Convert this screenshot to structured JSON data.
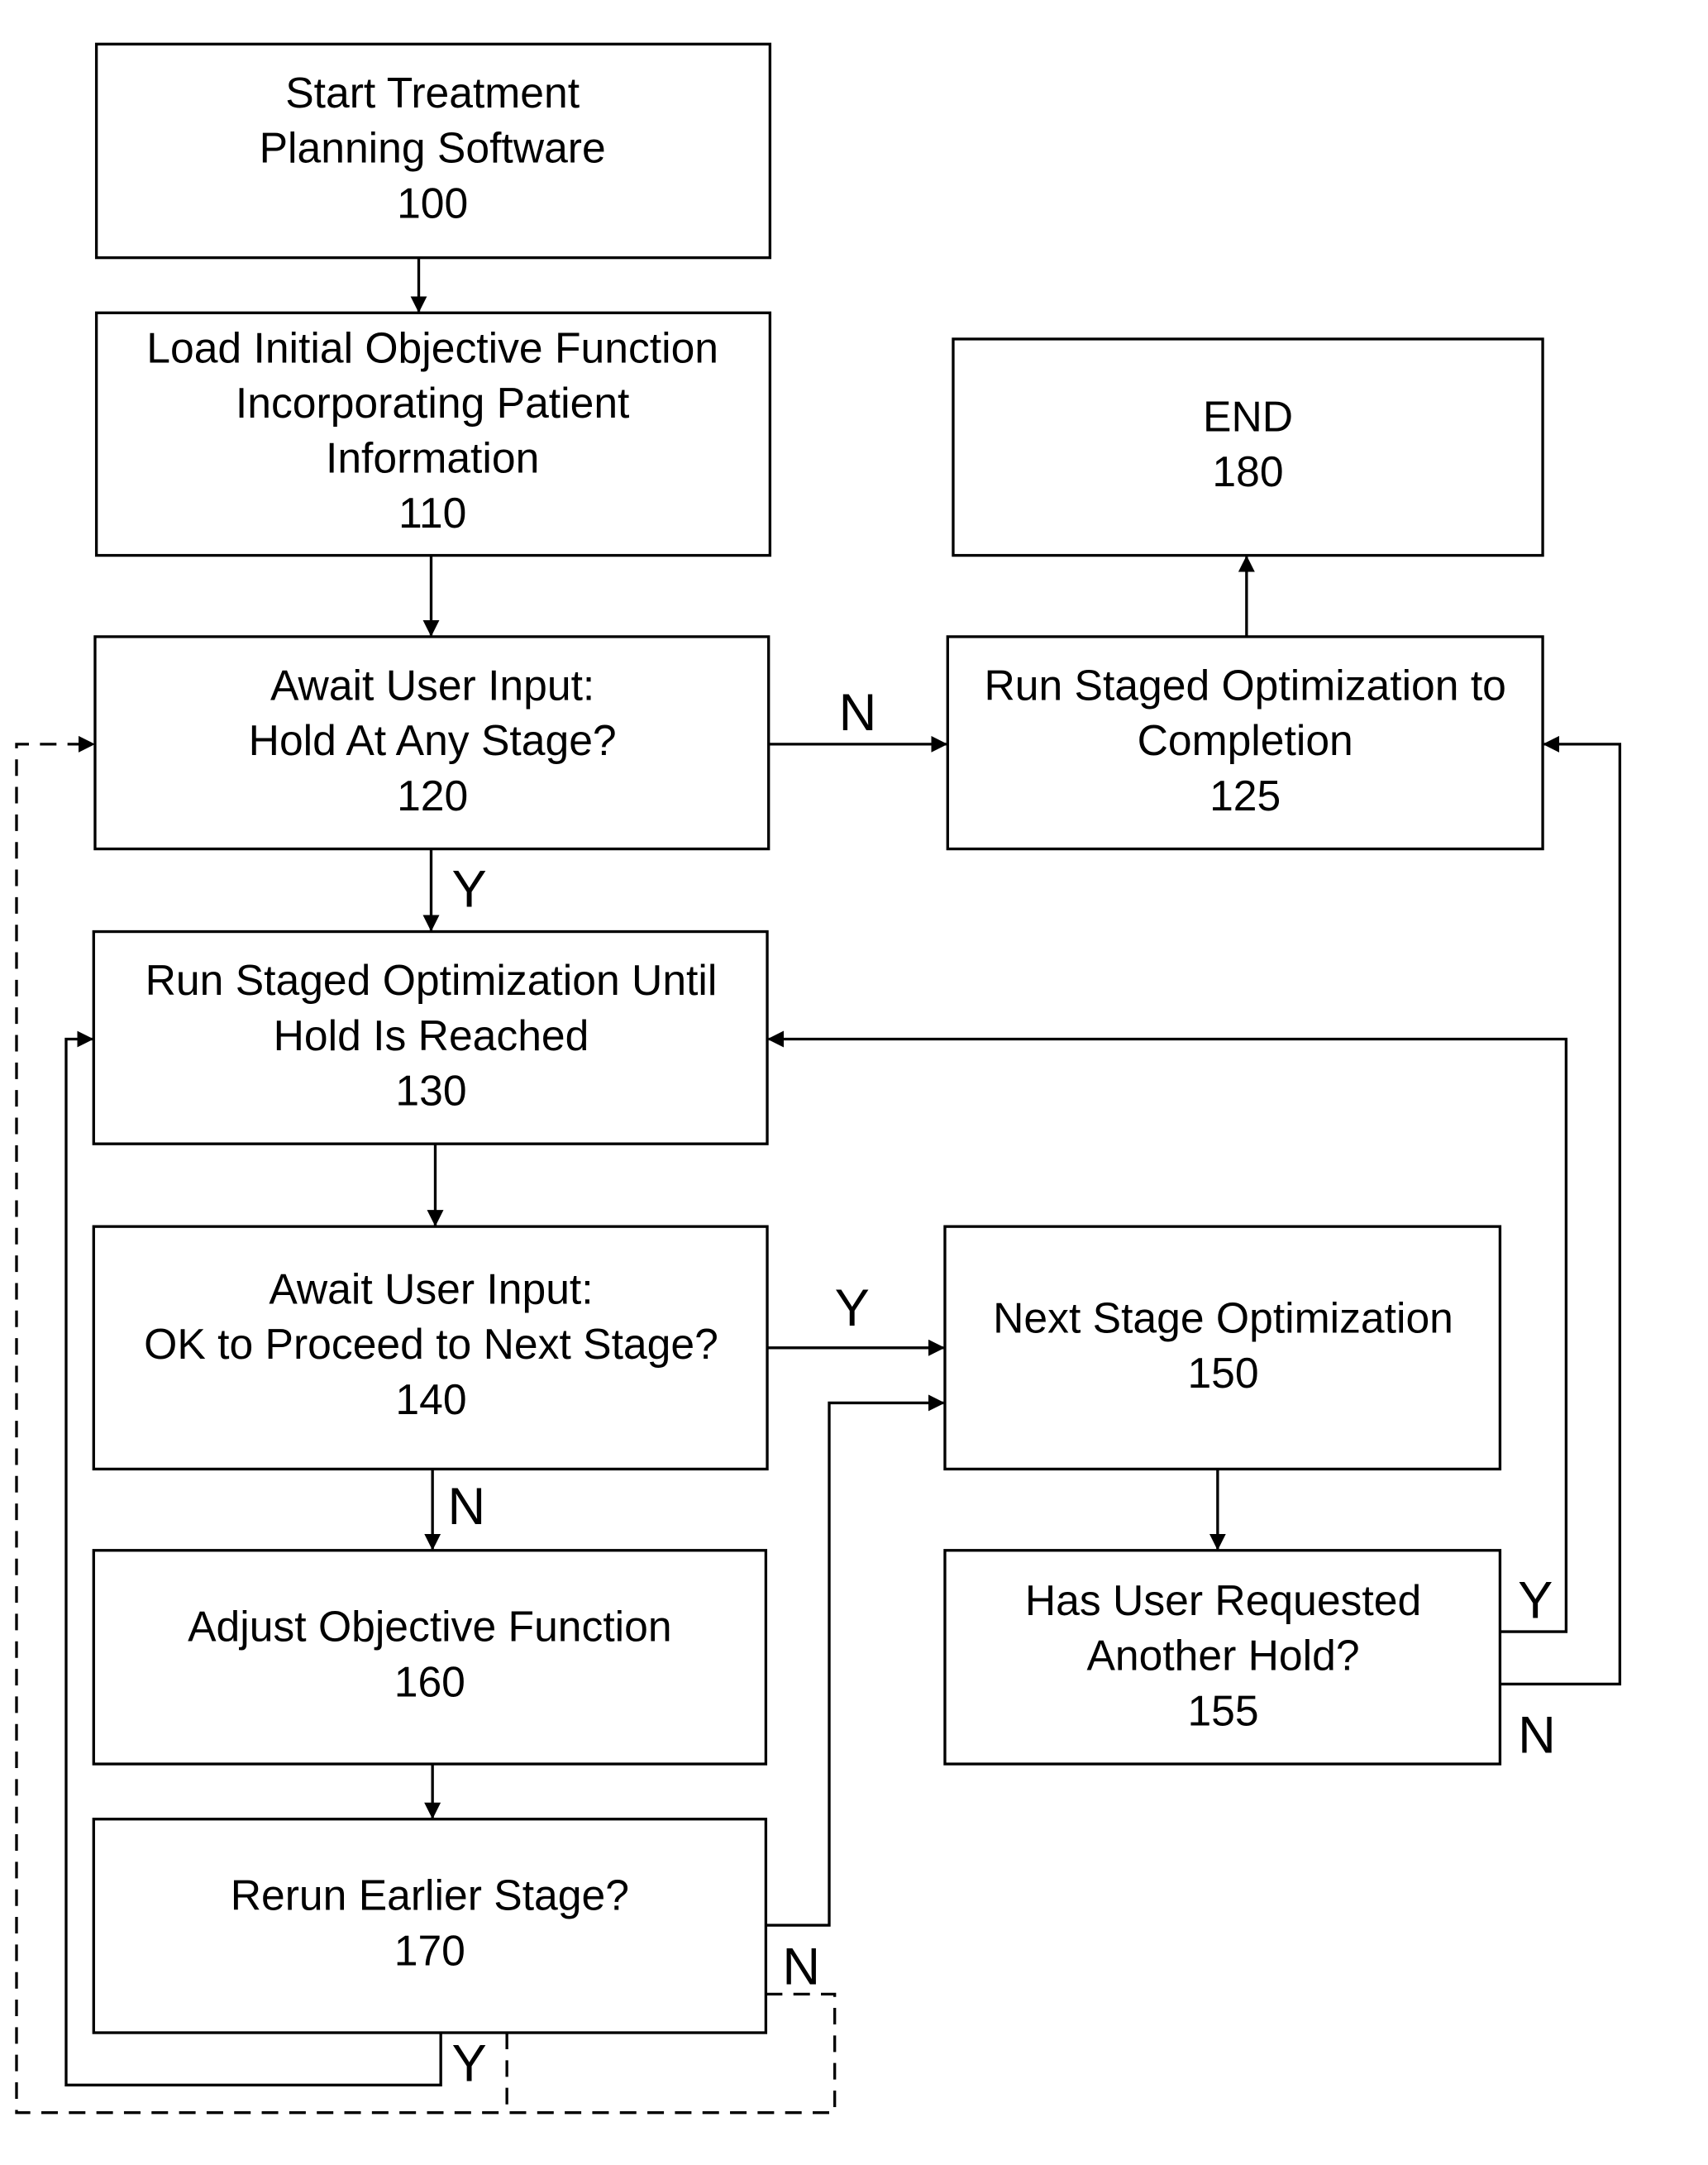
{
  "figure": {
    "nodes": [
      {
        "id": "100",
        "lines": [
          "Start Treatment",
          "Planning Software",
          "100"
        ]
      },
      {
        "id": "110",
        "lines": [
          "Load Initial Objective Function",
          "Incorporating Patient",
          "Information",
          "110"
        ]
      },
      {
        "id": "120",
        "lines": [
          "Await User Input:",
          "Hold At Any Stage?",
          "120"
        ]
      },
      {
        "id": "125",
        "lines": [
          "Run Staged Optimization to",
          "Completion",
          "125"
        ]
      },
      {
        "id": "130",
        "lines": [
          "Run Staged Optimization Until",
          "Hold Is Reached",
          "130"
        ]
      },
      {
        "id": "140",
        "lines": [
          "Await User Input:",
          "OK to Proceed to Next Stage?",
          "140"
        ]
      },
      {
        "id": "150",
        "lines": [
          "Next Stage Optimization",
          "150"
        ]
      },
      {
        "id": "155",
        "lines": [
          "Has User Requested",
          "Another Hold?",
          "155"
        ]
      },
      {
        "id": "160",
        "lines": [
          "Adjust Objective Function",
          "160"
        ]
      },
      {
        "id": "170",
        "lines": [
          "Rerun Earlier Stage?",
          "170"
        ]
      },
      {
        "id": "180",
        "lines": [
          "END",
          "180"
        ]
      }
    ],
    "edge_labels": {
      "n_120_125": "N",
      "y_120_130": "Y",
      "y_140_150": "Y",
      "n_140_160": "N",
      "y_155_130": "Y",
      "n_155_125": "N",
      "n_170": "N",
      "y_170": "Y"
    }
  }
}
